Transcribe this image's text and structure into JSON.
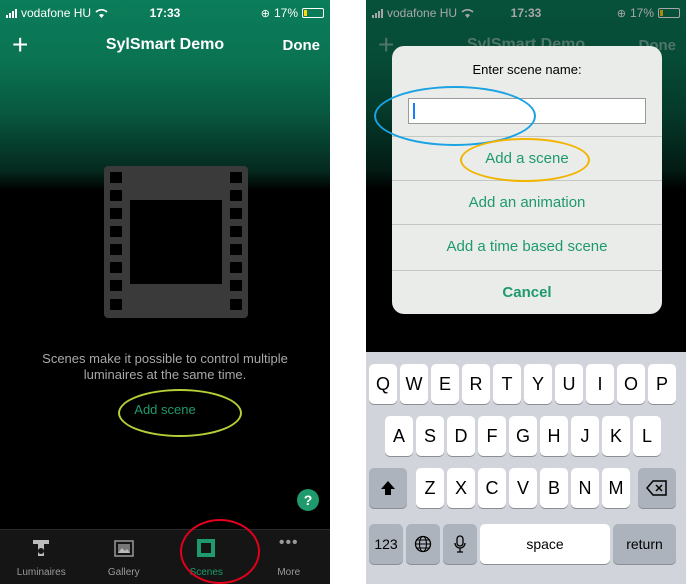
{
  "status_bar": {
    "carrier": "vodafone HU",
    "time": "17:33",
    "battery": "17%"
  },
  "screen1": {
    "nav": {
      "add": "+",
      "title": "SylSmart Demo",
      "done": "Done"
    },
    "description": "Scenes make it possible to control multiple luminaires at the same time.",
    "add_scene": "Add scene",
    "help": "?",
    "tabs": [
      {
        "label": "Luminaires",
        "icon": "luminaire-icon"
      },
      {
        "label": "Gallery",
        "icon": "gallery-icon"
      },
      {
        "label": "Scenes",
        "icon": "film-icon",
        "active": true
      },
      {
        "label": "More",
        "icon": "more-dots-icon"
      }
    ]
  },
  "screen2": {
    "nav": {
      "add": "+",
      "title": "SylSmart Demo",
      "done": "Done"
    },
    "alert": {
      "title": "Enter scene name:",
      "input_value": "",
      "actions": [
        "Add a scene",
        "Add an animation",
        "Add a time based scene",
        "Cancel"
      ]
    },
    "keyboard": {
      "row1": [
        "Q",
        "W",
        "E",
        "R",
        "T",
        "Y",
        "U",
        "I",
        "O",
        "P"
      ],
      "row2": [
        "A",
        "S",
        "D",
        "F",
        "G",
        "H",
        "J",
        "K",
        "L"
      ],
      "row3": [
        "Z",
        "X",
        "C",
        "V",
        "B",
        "N",
        "M"
      ],
      "numbers": "123",
      "space": "space",
      "return": "return"
    }
  },
  "annotations": {
    "colors": {
      "green": "#b5cf37",
      "red": "#e4001b",
      "blue": "#1aa2e3",
      "orange": "#f2b400"
    }
  },
  "accent_color": "#1f9a6c"
}
